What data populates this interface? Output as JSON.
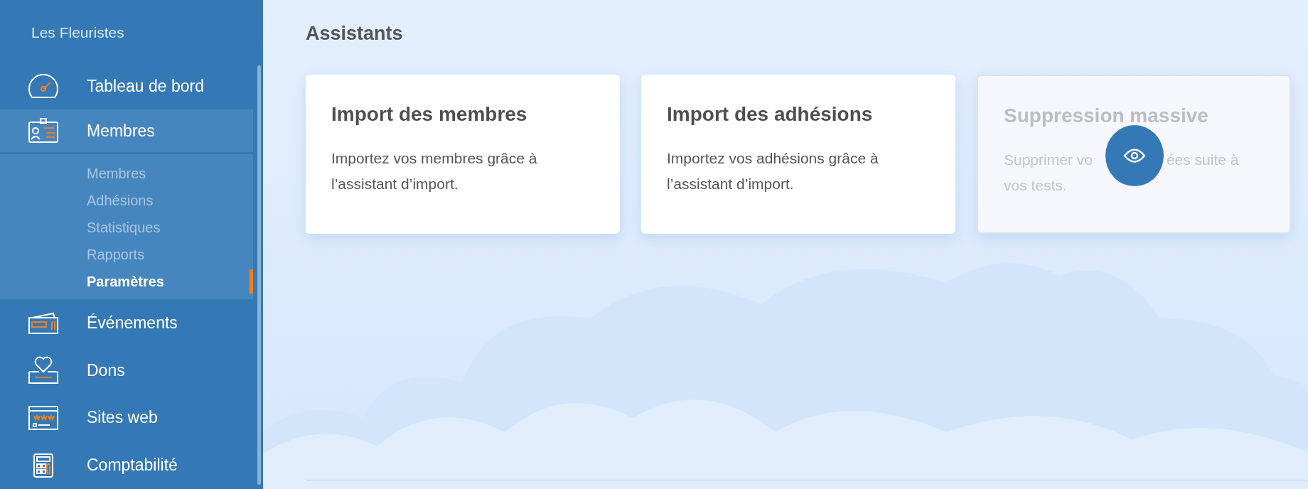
{
  "sidebar": {
    "org_name": "Les Fleuristes",
    "items": [
      {
        "label": "Tableau de bord",
        "expanded": false
      },
      {
        "label": "Membres",
        "expanded": true,
        "children": [
          {
            "label": "Membres",
            "selected": false
          },
          {
            "label": "Adhésions",
            "selected": false
          },
          {
            "label": "Statistiques",
            "selected": false
          },
          {
            "label": "Rapports",
            "selected": false
          },
          {
            "label": "Paramètres",
            "selected": true
          }
        ]
      },
      {
        "label": "Événements",
        "expanded": false
      },
      {
        "label": "Dons",
        "expanded": false
      },
      {
        "label": "Sites web",
        "expanded": false
      },
      {
        "label": "Comptabilité",
        "expanded": false
      }
    ]
  },
  "main": {
    "title": "Assistants",
    "cards": [
      {
        "title": "Import des membres",
        "description": "Importez vos membres grâce à l’assistant d’import.",
        "disabled": false
      },
      {
        "title": "Import des adhésions",
        "description": "Importez vos adhésions grâce à l’assistant d’import.",
        "disabled": false
      },
      {
        "title": "Suppression massive",
        "description_parts": [
          "Supprimer vo",
          "ées suite à",
          "vos tests."
        ],
        "disabled": true
      }
    ]
  }
}
